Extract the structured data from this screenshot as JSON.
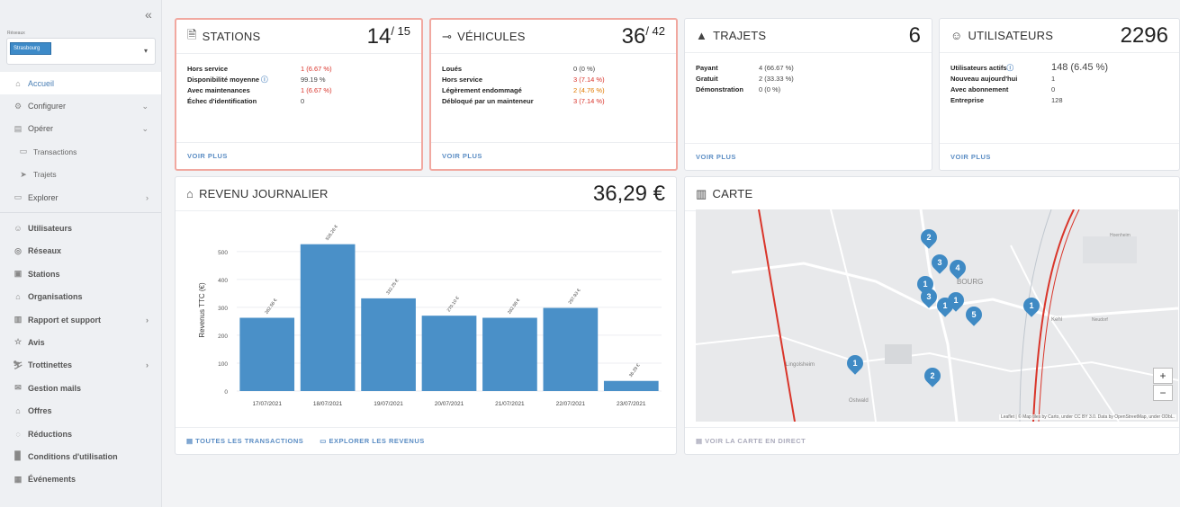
{
  "sidebar": {
    "collapse_icon": "«",
    "network_label": "Réseaux",
    "network_value": "Strasbourg",
    "items": [
      {
        "label": "Accueil",
        "icon": "home-icon"
      },
      {
        "label": "Configurer",
        "icon": "gear-icon"
      },
      {
        "label": "Opérer",
        "icon": "clipboard-icon"
      },
      {
        "label": "Transactions",
        "icon": "card-icon"
      },
      {
        "label": "Trajets",
        "icon": "send-icon"
      },
      {
        "label": "Explorer",
        "icon": "window-icon"
      },
      {
        "label": "Utilisateurs",
        "icon": "users-icon"
      },
      {
        "label": "Réseaux",
        "icon": "globe-icon"
      },
      {
        "label": "Stations",
        "icon": "station-icon"
      },
      {
        "label": "Organisations",
        "icon": "org-icon"
      },
      {
        "label": "Rapport et support",
        "icon": "report-icon"
      },
      {
        "label": "Avis",
        "icon": "star-icon"
      },
      {
        "label": "Trottinettes",
        "icon": "scooter-icon"
      },
      {
        "label": "Gestion mails",
        "icon": "mail-icon"
      },
      {
        "label": "Offres",
        "icon": "tag-icon"
      },
      {
        "label": "Réductions",
        "icon": "discount-icon"
      },
      {
        "label": "Conditions d'utilisation",
        "icon": "document-icon"
      },
      {
        "label": "Événements",
        "icon": "gift-icon"
      }
    ]
  },
  "stations": {
    "title": "STATIONS",
    "value": "14",
    "total": "/ 15",
    "rows": [
      {
        "k": "Hors service",
        "v": "1 (6.67 %)"
      },
      {
        "k": "Disponibilité moyenne",
        "v": "99.19 %"
      },
      {
        "k": "Avec maintenances",
        "v": "1 (6.67 %)"
      },
      {
        "k": "Échec d'identification",
        "v": "0"
      }
    ],
    "foot": "VOIR PLUS"
  },
  "vehicules": {
    "title": "VÉHICULES",
    "value": "36",
    "total": "/ 42",
    "rows": [
      {
        "k": "Loués",
        "v": "0 (0 %)"
      },
      {
        "k": "Hors service",
        "v": "3 (7.14 %)"
      },
      {
        "k": "Légèrement endommagé",
        "v": "2 (4.76 %)"
      },
      {
        "k": "Débloqué par un mainteneur",
        "v": "3 (7.14 %)"
      }
    ],
    "foot": "VOIR PLUS"
  },
  "trajets": {
    "title": "TRAJETS",
    "value": "6",
    "rows": [
      {
        "k": "Payant",
        "v": "4 (66.67 %)"
      },
      {
        "k": "Gratuit",
        "v": "2 (33.33 %)"
      },
      {
        "k": "Démonstration",
        "v": "0 (0 %)"
      }
    ],
    "foot": "VOIR PLUS"
  },
  "utilisateurs": {
    "title": "UTILISATEURS",
    "value": "2296",
    "rows": [
      {
        "k": "Utilisateurs actifs",
        "v": "148 (6.45 %)"
      },
      {
        "k": "Nouveau aujourd'hui",
        "v": "1"
      },
      {
        "k": "Avec abonnement",
        "v": "0"
      },
      {
        "k": "Entreprise",
        "v": "128"
      }
    ],
    "foot": "VOIR PLUS"
  },
  "revenu": {
    "title": "REVENU JOURNALIER",
    "value": "36,29 €",
    "foot_all": "TOUTES LES TRANSACTIONS",
    "foot_explore": "EXPLORER LES REVENUS"
  },
  "carte": {
    "title": "CARTE",
    "foot": "VOIR LA CARTE EN DIRECT",
    "attribution": "Leaflet | © Map tiles by Carto, under CC BY 3.0. Data by OpenStreetMap, under ODbL.",
    "zoom_in": "+",
    "zoom_out": "−",
    "map_labels": [
      "Lingolsheim",
      "Ostwald",
      "Kehl",
      "BOURG",
      "Hoenheim",
      "Neudorf"
    ],
    "markers": [
      "2",
      "3",
      "4",
      "1",
      "3",
      "1",
      "1",
      "5",
      "1",
      "1",
      "2"
    ]
  },
  "chart_data": {
    "type": "bar",
    "categories": [
      "17/07/2021",
      "18/07/2021",
      "19/07/2021",
      "20/07/2021",
      "21/07/2021",
      "22/07/2021",
      "23/07/2021"
    ],
    "values": [
      262.56,
      526.26,
      332.25,
      270.1,
      262.58,
      297.93,
      36.29
    ],
    "data_labels": [
      "262.56 €",
      "526.26 €",
      "332.25 €",
      "270.10 €",
      "262.58 €",
      "297.93 €",
      "36.29 €"
    ],
    "ylabel": "Revenus TTC (€)",
    "yticks": [
      0,
      100,
      200,
      300,
      400,
      500
    ],
    "ylim": [
      0,
      580
    ],
    "color": "#4a90c8",
    "grid": true
  }
}
